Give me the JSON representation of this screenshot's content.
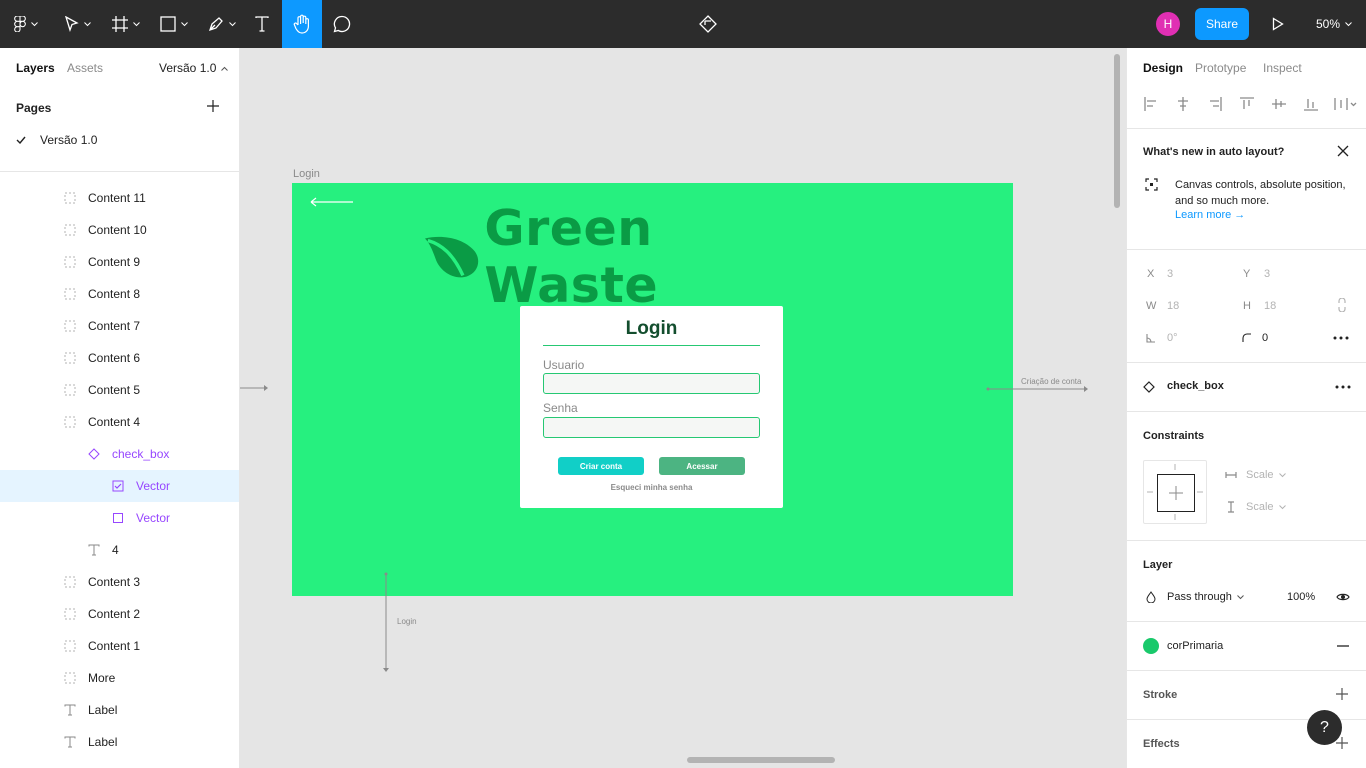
{
  "toolbar": {
    "avatar_initial": "H",
    "share_label": "Share",
    "zoom_label": "50%"
  },
  "left_panel": {
    "tabs": [
      "Layers",
      "Assets"
    ],
    "page_selector": "Versão 1.0",
    "pages_title": "Pages",
    "pages": [
      {
        "label": "Versão 1.0",
        "current": true
      }
    ],
    "layers": [
      {
        "label": "Content 11",
        "icon": "frame-icon"
      },
      {
        "label": "Content 10",
        "icon": "frame-icon"
      },
      {
        "label": "Content 9",
        "icon": "frame-icon"
      },
      {
        "label": "Content 8",
        "icon": "frame-icon"
      },
      {
        "label": "Content 7",
        "icon": "frame-icon"
      },
      {
        "label": "Content 6",
        "icon": "frame-icon"
      },
      {
        "label": "Content 5",
        "icon": "frame-icon"
      },
      {
        "label": "Content 4",
        "icon": "frame-icon"
      },
      {
        "label": "check_box",
        "icon": "component-icon"
      },
      {
        "label": "Vector",
        "icon": "vector-checked-icon"
      },
      {
        "label": "Vector",
        "icon": "vector-empty-icon"
      },
      {
        "label": "4",
        "icon": "text-icon"
      },
      {
        "label": "Content 3",
        "icon": "frame-icon"
      },
      {
        "label": "Content 2",
        "icon": "frame-icon"
      },
      {
        "label": "Content 1",
        "icon": "frame-icon"
      },
      {
        "label": "More",
        "icon": "frame-icon"
      },
      {
        "label": "Label",
        "icon": "text-icon"
      },
      {
        "label": "Label",
        "icon": "text-icon"
      }
    ]
  },
  "canvas": {
    "frame_label": "Login",
    "logo_text": "Green Waste",
    "login_card": {
      "title": "Login",
      "user_label": "Usuario",
      "password_label": "Senha",
      "create_button": "Criar conta",
      "access_button": "Acessar",
      "forgot_link": "Esqueci minha senha"
    },
    "proto_right_label": "Criação de conta",
    "proto_bottom_label": "Login"
  },
  "right_panel": {
    "tabs": [
      "Design",
      "Prototype",
      "Inspect"
    ],
    "whats_new": {
      "title": "What's new in auto layout?",
      "body": "Canvas controls, absolute position, and so much more.",
      "link": "Learn more →"
    },
    "props": {
      "x_label": "X",
      "x_value": "3",
      "y_label": "Y",
      "y_value": "3",
      "w_label": "W",
      "w_value": "18",
      "h_label": "H",
      "h_value": "18",
      "rotation": "0°",
      "radius": "0"
    },
    "component_name": "check_box",
    "constraints": {
      "title": "Constraints",
      "horizontal": "Scale",
      "vertical": "Scale"
    },
    "layer": {
      "title": "Layer",
      "blend_mode": "Pass through",
      "opacity": "100%"
    },
    "fill": {
      "style_name": "corPrimaria",
      "color": "#19c96b"
    },
    "stroke_title": "Stroke",
    "effects_title": "Effects",
    "help_label": "?"
  },
  "colors": {
    "toolbar_bg": "#2c2c2c",
    "accent": "#0d99ff",
    "frame_green": "#26f07f",
    "logo_green": "#0a9b45",
    "component_purple": "#9747ff"
  }
}
